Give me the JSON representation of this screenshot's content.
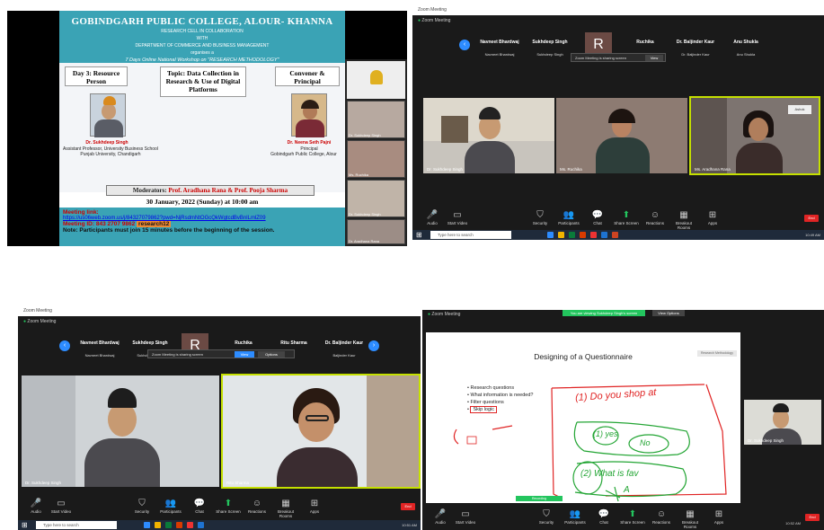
{
  "flyer": {
    "college": "GOBINDGARH PUBLIC COLLEGE, ALOUR- KHANNA",
    "cell": "RESEARCH CELL IN COLLABORATION",
    "with": "WITH",
    "dept": "DEPARTMENT OF COMMERCE AND BUSINESS MANAGEMENT",
    "organises": "organises a",
    "workshop": "7 Days Online National Workshop on \"RESEARCH METHODOLOGY\"",
    "day_box": "Day 3: Resource Person",
    "topic_box": "Topic: Data Collection in Research & Use of Digital Platforms",
    "convener_box": "Convener & Principal",
    "rp_name": "Dr. Sukhdeep Singh",
    "rp_desc": "Assistant Professor, University Business School Punjab University, Chandigarh",
    "pr_name": "Dr. Neena Seth Pajni",
    "pr_title": "Principal",
    "pr_college": "Gobindgarh Public College, Alour",
    "moderators_label": "Moderators:",
    "moderators": "Prof. Aradhana Rana & Prof. Pooja Sharma",
    "date": "30 January, 2022 (Sunday) at 10:00 am",
    "meeting_link_label": "Meeting link:",
    "meeting_link": "https://us06web.zoom.us/j/84327079862?pwd=NjRsdmNtOGcQkWgtcdBvBnlLmlZ09",
    "meeting_id_label": "Meeting ID:",
    "meeting_id": "843 2707 9862",
    "passcode": "research12",
    "note": "Note: Participants must join 15 minutes before the beginning of the session.",
    "side_names": [
      "Dr. Sukhdeep Singh",
      "Ms. Ruchika",
      "Dr. Sukhdeep Singh",
      "Dr. Aradhana Rana"
    ]
  },
  "zoom1": {
    "title": "Zoom Meeting",
    "top_left": "Zoom Meeting",
    "participants": [
      {
        "name": "Navneet Bhardwaj",
        "sub": "Navneet Bhardwaj"
      },
      {
        "name": "Sukhdeep Singh",
        "sub": "Sukhdeep Singh"
      },
      {
        "name": "R",
        "sub": ""
      },
      {
        "name": "Ruchika",
        "sub": ""
      },
      {
        "name": "Dr. Baljinder Kaur",
        "sub": "Dr. Baljinder Kaur"
      },
      {
        "name": "Anu Shukla",
        "sub": "Anu Shukla"
      }
    ],
    "popup_text": "Zoom Meeting is sharing screen",
    "popup_btn": "View",
    "videos": [
      {
        "name": "Dr. Sukhdeep Singh"
      },
      {
        "name": "Ms. Ruchika"
      },
      {
        "name": "Ms. Aradhana Rana"
      }
    ],
    "corner_label": "Ashok",
    "taskbar_search": "Type here to search",
    "taskbar_time": "10:49 AM"
  },
  "zoom2": {
    "title": "Zoom Meeting",
    "top_left": "Zoom Meeting",
    "participants": [
      {
        "name": "Navneet Bhardwaj",
        "sub": "Navneet Bhardwaj"
      },
      {
        "name": "Sukhdeep Singh",
        "sub": "Sukhdeep Singh"
      },
      {
        "name": "R",
        "sub": ""
      },
      {
        "name": "Ruchika",
        "sub": ""
      },
      {
        "name": "Ritu Sharma",
        "sub": ""
      },
      {
        "name": "Dr. Baljinder Kaur",
        "sub": "Baljinder Kaur"
      }
    ],
    "popup_text": "Zoom Meeting is sharing screen",
    "popup_btn1": "View",
    "popup_btn2": "Options",
    "videos": [
      {
        "name": "Dr. Sukhdeep Singh"
      },
      {
        "name": "Ritu Sharma"
      }
    ],
    "taskbar_search": "Type here to search",
    "taskbar_time": "10:51 AM"
  },
  "zoom3": {
    "top_left": "Zoom Meeting",
    "share_banner": "You are viewing Sukhdeep Singh's screen",
    "view_options": "View Options",
    "slide_title": "Designing of a Questionnaire",
    "slide_corner": "Research Methodology",
    "bullets": [
      "Research questions",
      "What information is needed?",
      "Filter questions",
      "Skip logic"
    ],
    "ink_line": "(1) Do you shop at",
    "ink_yes": "(1) yes",
    "ink_no": "No",
    "ink_2": "(2) What is fav",
    "ink_A": "A",
    "speaker_name": "Dr. Sukhdeep Singh",
    "recording": "Recording",
    "taskbar_time": "10:52 AM"
  },
  "toolbar": [
    "Audio",
    "Start Video",
    "Security",
    "Participants",
    "Chat",
    "Share Screen",
    "Reactions",
    "Breakout Rooms",
    "Apps"
  ],
  "end_label": "End"
}
